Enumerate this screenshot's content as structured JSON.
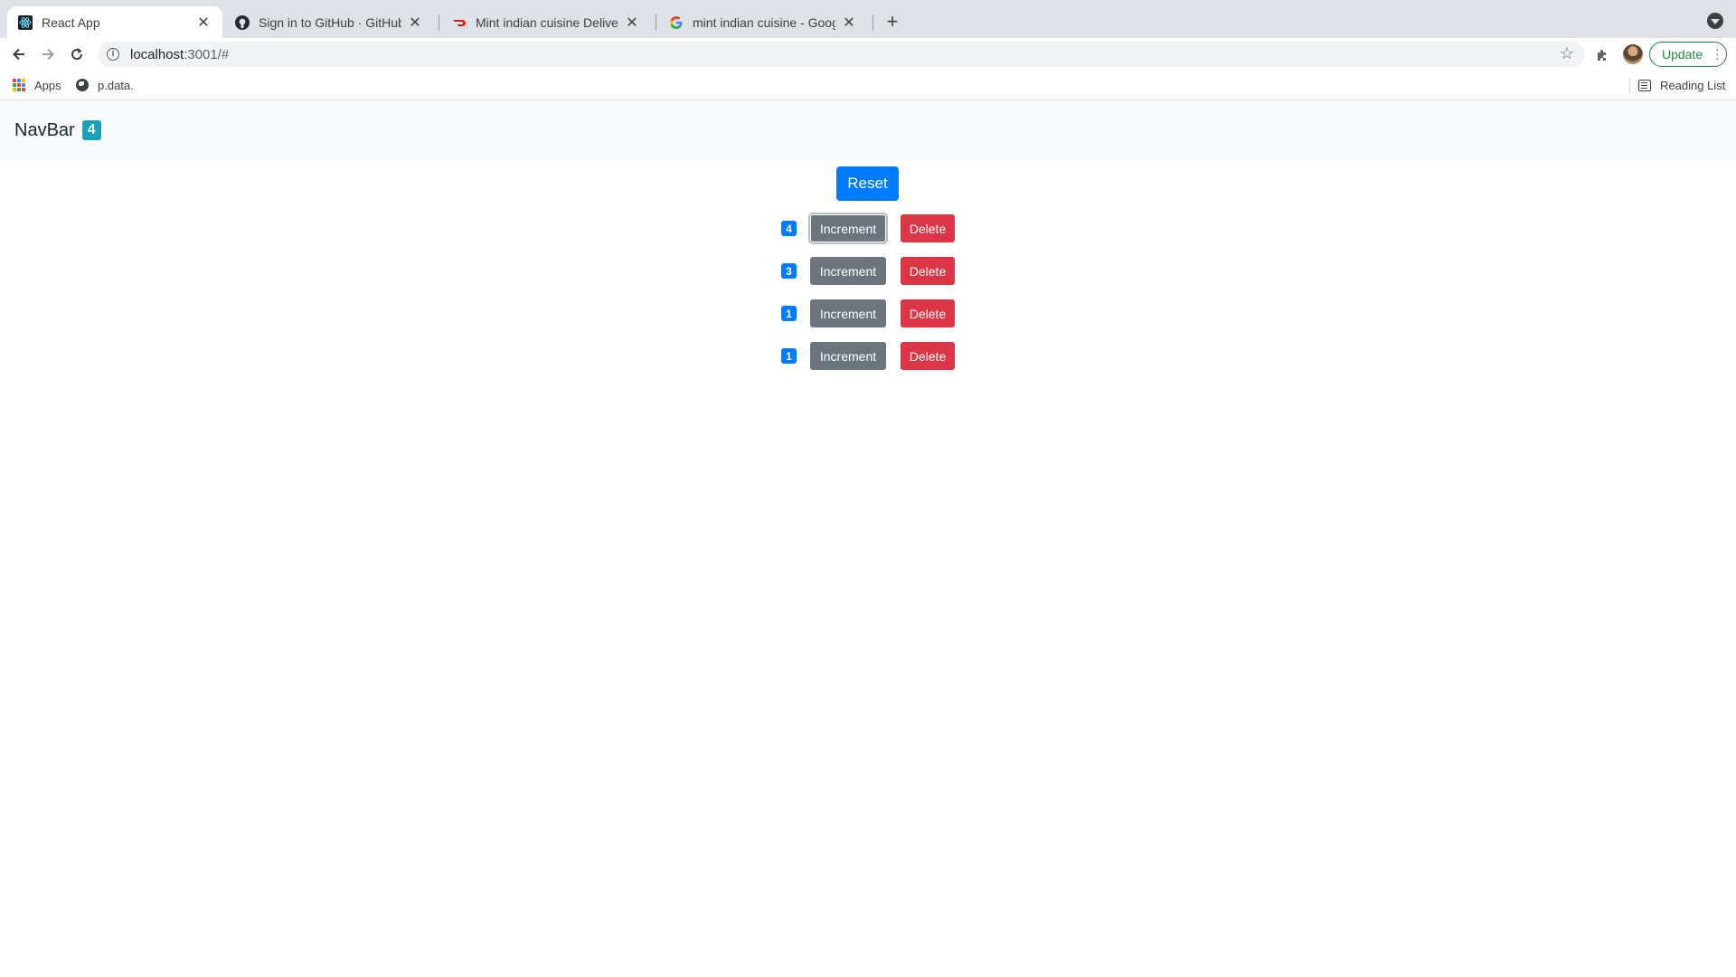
{
  "browser": {
    "tabs": [
      {
        "title": "React App",
        "favicon": "react-icon",
        "active": true
      },
      {
        "title": "Sign in to GitHub · GitHub",
        "favicon": "github-icon",
        "active": false
      },
      {
        "title": "Mint indian cuisine Delivery in C",
        "favicon": "doordash-icon",
        "active": false
      },
      {
        "title": "mint indian cuisine - Google Se",
        "favicon": "google-icon",
        "active": false
      }
    ],
    "url_host": "localhost",
    "url_path": ":3001/#",
    "update_label": "Update",
    "bookmarks": {
      "apps_label": "Apps",
      "pdata_label": "p.data.",
      "reading_list_label": "Reading List"
    }
  },
  "app": {
    "brand": "NavBar",
    "total_count": "4",
    "reset_label": "Reset",
    "counters": [
      {
        "value": "4",
        "increment_label": "Increment",
        "delete_label": "Delete"
      },
      {
        "value": "3",
        "increment_label": "Increment",
        "delete_label": "Delete"
      },
      {
        "value": "1",
        "increment_label": "Increment",
        "delete_label": "Delete"
      },
      {
        "value": "1",
        "increment_label": "Increment",
        "delete_label": "Delete"
      }
    ]
  },
  "colors": {
    "primary": "#007bff",
    "secondary": "#6c757d",
    "danger": "#dc3545",
    "info": "#17a2b8",
    "update_green": "#1e8e3e"
  }
}
